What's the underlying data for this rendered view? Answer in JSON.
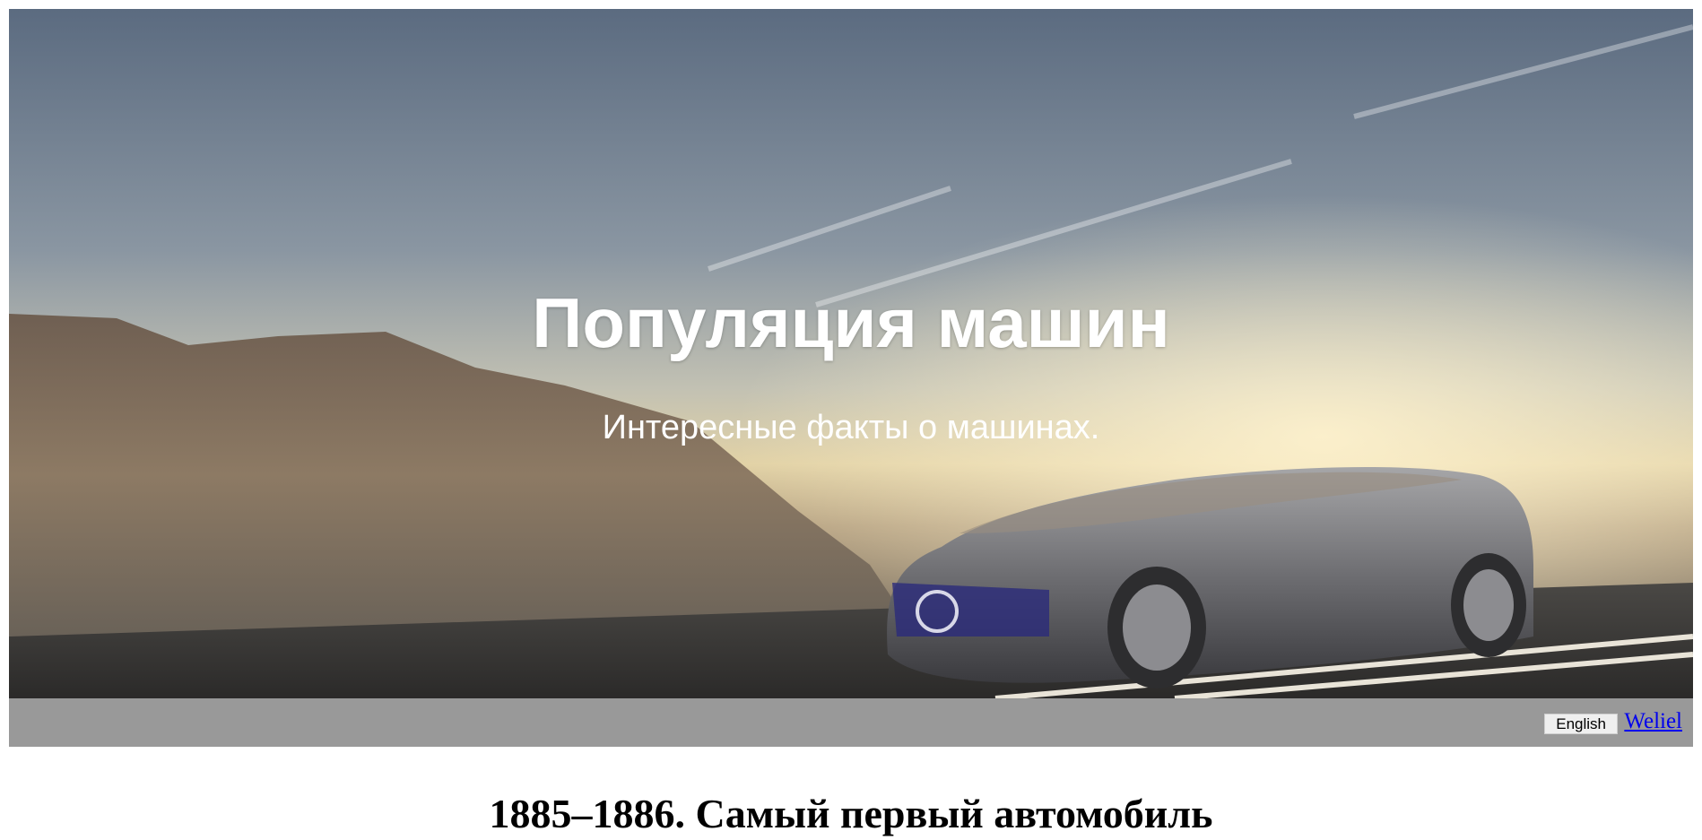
{
  "hero": {
    "title": "Популяция машин",
    "subtitle": "Интересные факты о машинах."
  },
  "nav": {
    "language_button": "English",
    "site_link": "Weliel"
  },
  "content": {
    "section_heading": "1885–1886. Самый первый автомобиль"
  },
  "colors": {
    "nav_bar": "#999999",
    "link": "#0000ee",
    "hero_text": "#ffffff"
  }
}
